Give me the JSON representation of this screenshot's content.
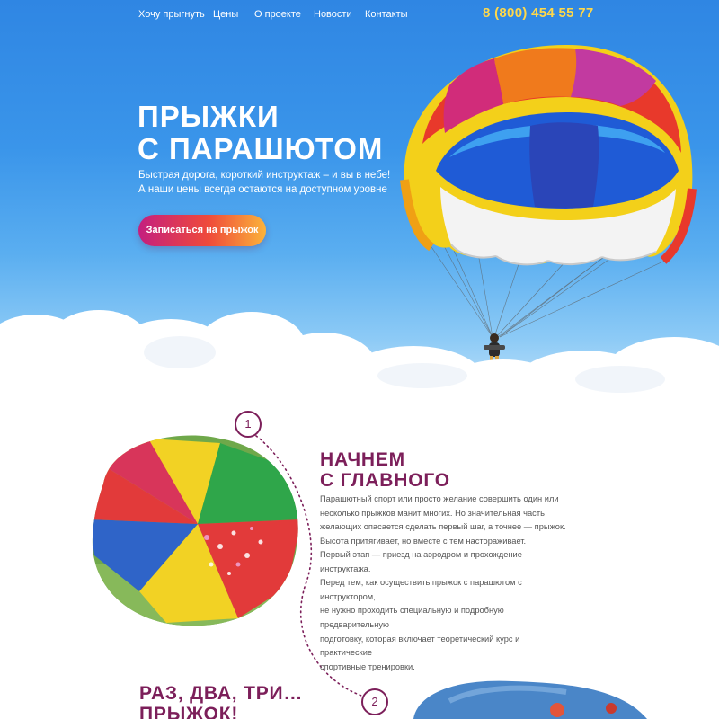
{
  "nav": {
    "items": [
      {
        "label": "Хочу прыгнуть"
      },
      {
        "label": "Цены"
      },
      {
        "label": "О проекте"
      },
      {
        "label": "Новости"
      },
      {
        "label": "Контакты"
      }
    ],
    "phone": "8 (800) 454 55 77"
  },
  "hero": {
    "title_line1": "ПРЫЖКИ",
    "title_line2": "С ПАРАШЮТОМ",
    "subtitle_line1": "Быстрая дорога, короткий инструктаж – и вы в небе!",
    "subtitle_line2": "А наши цены всегда остаются на доступном уровне",
    "cta_label": "Записаться на прыжок"
  },
  "section1": {
    "step": "1",
    "title_line1": "НАЧНЕМ",
    "title_line2": "С ГЛАВНОГО",
    "paragraph1": [
      "Парашютный спорт или просто желание совершить один или",
      "несколько прыжков манит многих. Но значительная часть",
      "желающих опасается сделать первый шаг, а точнее — прыжок.",
      "Высота притягивает, но вместе с тем настораживает."
    ],
    "paragraph2": [
      "Первый этап — приезд на аэродром и прохождение инструктажа.",
      "Перед тем, как осуществить прыжок с парашютом с инструктором,",
      "не нужно проходить специальную и подробную предварительную",
      "подготовку, которая включает теоретический курс и практические",
      "спортивные тренировки."
    ]
  },
  "section2": {
    "step": "2",
    "title_line1": "РАЗ, ДВА, ТРИ…",
    "title_line2": "ПРЫЖОК!"
  },
  "colors": {
    "sky": "#3a95ea",
    "accent": "#7c1f5a",
    "phone": "#ffd84a",
    "cta_start": "#c41f7f",
    "cta_end": "#fbb33a"
  }
}
